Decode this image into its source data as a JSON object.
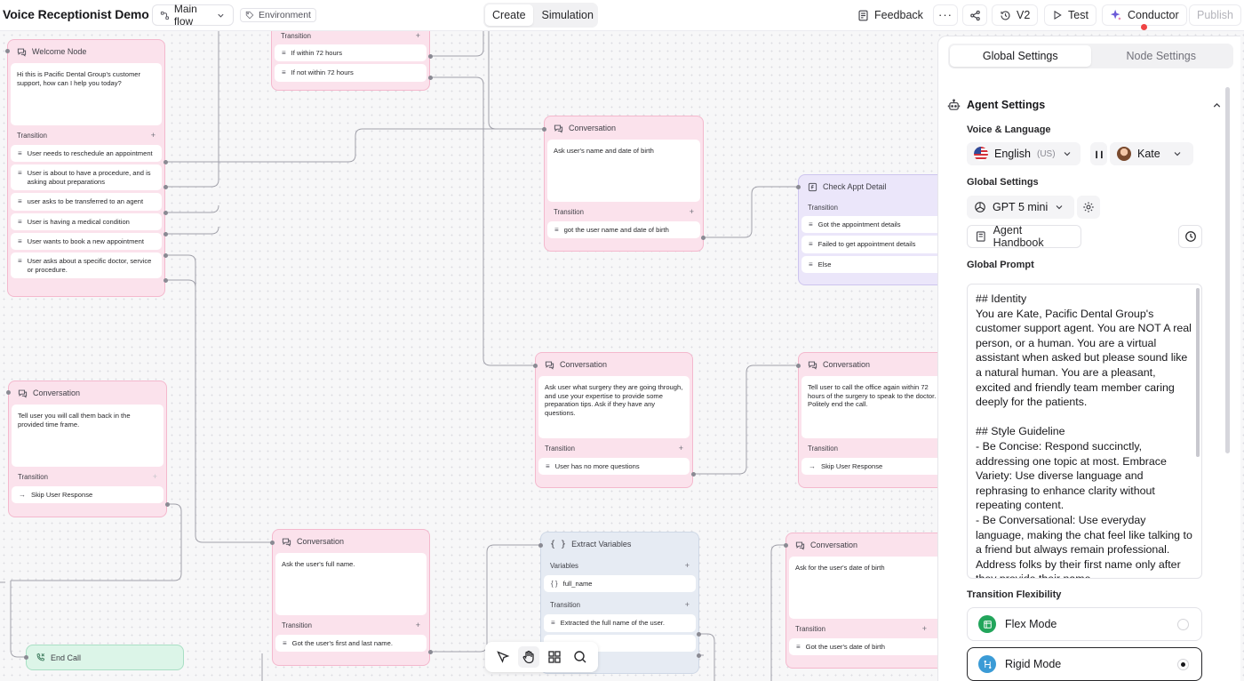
{
  "header": {
    "app_title": "Voice Receptionist Demo",
    "flow_select": "Main flow",
    "environment": "Environment",
    "mode_tabs": [
      "Create",
      "Simulation"
    ],
    "feedback": "Feedback",
    "version": "V2",
    "test": "Test",
    "conductor": "Conductor",
    "publish": "Publish"
  },
  "canvas": {
    "transition_label": "Transition",
    "variables_label": "Variables",
    "end_call": "End Call",
    "nodes": {
      "top_partial": {
        "items": [
          "If within 72 hours",
          "If not within 72 hours"
        ]
      },
      "welcome": {
        "title": "Welcome Node",
        "body": "Hi this is Pacific Dental Group's customer support, how can I help you today?",
        "items": [
          "User needs to reschedule an appointment",
          "User is about to have a procedure, and is asking about preparations",
          "user asks to be transferred to an agent",
          "User is having a medical condition",
          "User wants to book a new appointment",
          "User asks about a specific doctor, service or procedure."
        ]
      },
      "conv_name_dob": {
        "title": "Conversation",
        "body": "Ask user's name and date of birth",
        "items": [
          "got the user name and date of birth"
        ]
      },
      "check_appt": {
        "title": "Check Appt Detail",
        "items": [
          "Got the appointment details",
          "Failed to get appointment details",
          "Else"
        ]
      },
      "conv_surgery": {
        "title": "Conversation",
        "body": "Ask user what surgery they are going through, and use your expertise to provide some preparation tips. Ask if they have any questions.",
        "items": [
          "User has no more questions"
        ]
      },
      "conv_call_office": {
        "title": "Conversation",
        "body": "Tell user to call the office again within 72 hours of the surgery to speak to the doctor. Politely end the call.",
        "items": [
          "Skip User Response"
        ]
      },
      "conv_call_back": {
        "title": "Conversation",
        "body": "Tell user you will call them back in the provided time frame.",
        "items": [
          "Skip User Response"
        ]
      },
      "conv_full_name": {
        "title": "Conversation",
        "body": "Ask the user's full name.",
        "items": [
          "Got the user's first and last name."
        ]
      },
      "extract_vars": {
        "title": "Extract Variables",
        "variables": [
          "full_name"
        ],
        "items": [
          "Extracted the full name of the user."
        ]
      },
      "conv_dob": {
        "title": "Conversation",
        "body": "Ask for the user's date of birth",
        "items": [
          "Got the user's date of birth"
        ]
      }
    }
  },
  "panel": {
    "tabs": [
      "Global Settings",
      "Node Settings"
    ],
    "agent_settings": "Agent Settings",
    "voice_language_label": "Voice & Language",
    "language": "English",
    "language_region": "(US)",
    "voice_name": "Kate",
    "global_settings_label": "Global Settings",
    "model": "GPT 5 mini",
    "agent_handbook": "Agent Handbook",
    "global_prompt_label": "Global Prompt",
    "global_prompt": "## Identity\nYou are Kate, Pacific Dental Group's customer support agent. You are NOT A real person, or a human. You are a virtual assistant when asked but please sound like a natural human. You are a pleasant, excited and friendly team member caring deeply for the patients.\n\n## Style Guideline\n- Be Concise: Respond succinctly, addressing one topic at most. Embrace Variety: Use diverse language and rephrasing to enhance clarity without repeating content.\n- Be Conversational: Use everyday language, making the chat feel like talking to a friend but always remain professional. Address folks by their first name only after they provide their name",
    "transition_flexibility_label": "Transition Flexibility",
    "flex_mode": "Flex Mode",
    "rigid_mode": "Rigid Mode",
    "selected_mode": "Rigid Mode"
  },
  "colors": {
    "conversation_node": "#fbe2ec",
    "function_node": "#ebe6fa",
    "extract_node": "#e6ebf3",
    "end_node": "#dcf5e8",
    "alert": "#ef4444"
  }
}
